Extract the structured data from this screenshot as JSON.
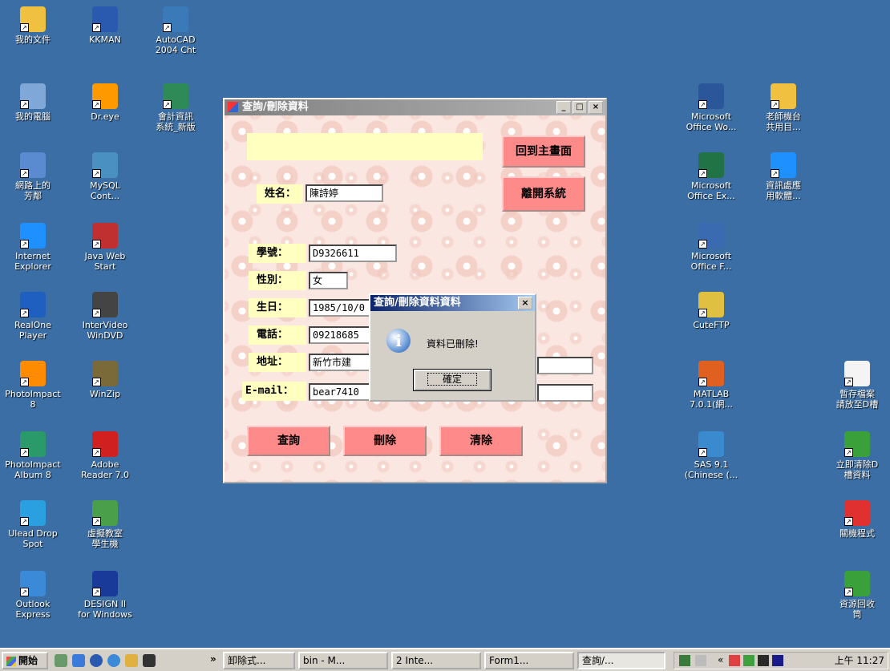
{
  "desktop_icons_left": [
    {
      "label": "我的文件",
      "icon": "folder-documents-icon",
      "color": "#f0c040"
    },
    {
      "label": "KKMAN",
      "icon": "kkman-icon",
      "color": "#2a5ab0"
    },
    {
      "label": "AutoCAD\n2004 Cht",
      "icon": "autocad-icon",
      "color": "#3a7ab8"
    },
    {
      "label": "我的電腦",
      "icon": "computer-icon",
      "color": "#7fa8d8"
    },
    {
      "label": "Dr.eye",
      "icon": "dreye-icon",
      "color": "#ff9900"
    },
    {
      "label": "會計資訊\n系統_新版",
      "icon": "excel-file-icon",
      "color": "#2e8b57"
    },
    {
      "label": "網路上的\n芳鄰",
      "icon": "network-icon",
      "color": "#5a8ad0"
    },
    {
      "label": "MySQL\nCont...",
      "icon": "mysql-icon",
      "color": "#4a90c0"
    },
    {
      "label": "Internet\nExplorer",
      "icon": "ie-icon",
      "color": "#1e90ff"
    },
    {
      "label": "Java Web\nStart",
      "icon": "java-icon",
      "color": "#c03030"
    },
    {
      "label": "RealOne\nPlayer",
      "icon": "realone-icon",
      "color": "#1f5fbf"
    },
    {
      "label": "InterVideo\nWinDVD",
      "icon": "windvd-icon",
      "color": "#444444"
    },
    {
      "label": "PhotoImpact\n8",
      "icon": "photoimpact-icon",
      "color": "#ff8c00"
    },
    {
      "label": "WinZip",
      "icon": "winzip-icon",
      "color": "#7a6a3a"
    },
    {
      "label": "PhotoImpact\nAlbum 8",
      "icon": "album-icon",
      "color": "#2a9a6a"
    },
    {
      "label": "Adobe\nReader 7.0",
      "icon": "adobe-reader-icon",
      "color": "#d02020"
    },
    {
      "label": "Ulead Drop\nSpot",
      "icon": "dropspot-icon",
      "color": "#2aa0e0"
    },
    {
      "label": "虛擬教室\n學生機",
      "icon": "virtual-class-icon",
      "color": "#4aa04a"
    },
    {
      "label": "Outlook\nExpress",
      "icon": "outlook-icon",
      "color": "#3a8ad8"
    },
    {
      "label": "DESIGN II\nfor Windows",
      "icon": "design2-icon",
      "color": "#1a3a9a"
    }
  ],
  "desktop_icons_right": [
    {
      "label": "Microsoft\nOffice Wo...",
      "icon": "word-icon",
      "color": "#2b579a"
    },
    {
      "label": "老師機台\n共用目...",
      "icon": "shared-folder-icon",
      "color": "#f0c040"
    },
    {
      "label": "Microsoft\nOffice Ex...",
      "icon": "excel-icon",
      "color": "#217346"
    },
    {
      "label": "資訊處應\n用軟體...",
      "icon": "ie-shortcut-icon",
      "color": "#1e90ff"
    },
    {
      "label": "Microsoft\nOffice F...",
      "icon": "frontpage-icon",
      "color": "#3a6ab0"
    },
    {
      "label": "CuteFTP",
      "icon": "cuteftp-icon",
      "color": "#e0c040"
    },
    {
      "label": "MATLAB\n7.0.1(網...",
      "icon": "matlab-icon",
      "color": "#e06020"
    },
    {
      "label": "SAS 9.1\n(Chinese (...",
      "icon": "sas-icon",
      "color": "#3a8ad0"
    },
    {
      "label": "暫存檔案\n請放至D槽",
      "icon": "text-file-icon",
      "color": "#f4f4f4"
    },
    {
      "label": "立即清除D\n槽資料",
      "icon": "recycle-shortcut-icon",
      "color": "#3aa03a"
    },
    {
      "label": "關機程式",
      "icon": "shutdown-icon",
      "color": "#e03030"
    },
    {
      "label": "資源回收\n筒",
      "icon": "recycle-bin-icon",
      "color": "#3aa03a"
    }
  ],
  "window": {
    "title": "查詢/刪除資料",
    "min": "_",
    "max": "□",
    "close": "×",
    "btn_home": "回到主畫面",
    "btn_exit": "離開系統",
    "name_label": "姓名：",
    "name_value": "陳詩婷",
    "id_label": "學號：",
    "id_value": "D9326611",
    "gender_label": "性別：",
    "gender_value": "女",
    "birth_label": "生日：",
    "birth_value": "1985/10/0",
    "phone_label": "電話：",
    "phone_value": "09218685",
    "addr_label": "地址：",
    "addr_value": "新竹市建",
    "email_label": "E-mail：",
    "email_value": "bear7410",
    "btn_query": "查詢",
    "btn_delete": "刪除",
    "btn_clear": "清除"
  },
  "dialog": {
    "title": "查詢/刪除資料資料",
    "close": "×",
    "info_glyph": "i",
    "message": "資料已刪除!",
    "ok": "確定"
  },
  "taskbar": {
    "start": "開始",
    "more": "»",
    "tasks": [
      "卸除式...",
      "bin - M...",
      "2 Inte...",
      "Form1...",
      "查詢/..."
    ],
    "tray_more": "«",
    "clock": "上午 11:27"
  }
}
